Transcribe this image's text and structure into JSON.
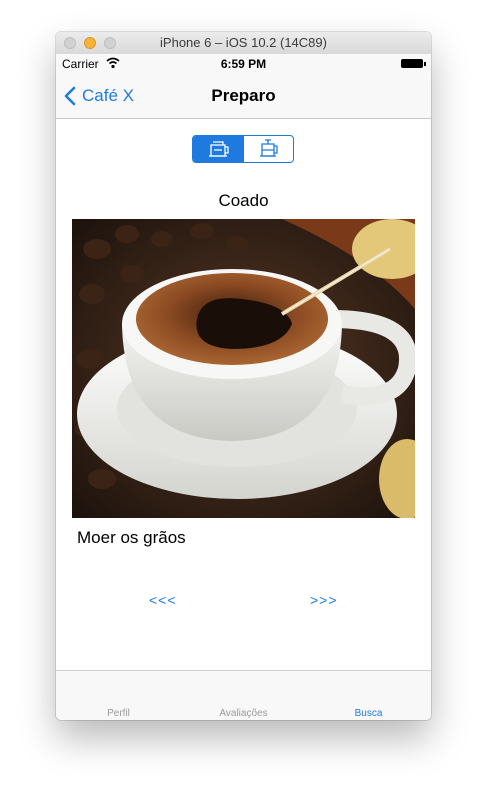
{
  "window": {
    "title": "iPhone 6 – iOS 10.2 (14C89)"
  },
  "status_bar": {
    "carrier": "Carrier",
    "time": "6:59 PM"
  },
  "nav": {
    "back_label": "Café X",
    "title": "Preparo"
  },
  "segments": [
    {
      "icon": "coffee-pot-icon",
      "selected": true
    },
    {
      "icon": "french-press-icon",
      "selected": false
    }
  ],
  "content": {
    "method": "Coado",
    "step": "Moer os grãos",
    "prev": "<<<",
    "next": ">>>"
  },
  "tabs": [
    {
      "label": "Perfil",
      "active": false
    },
    {
      "label": "Avaliações",
      "active": false
    },
    {
      "label": "Busca",
      "active": true
    }
  ],
  "colors": {
    "accent": "#1f7ae0",
    "inactive_tab": "#9a9a9a"
  }
}
